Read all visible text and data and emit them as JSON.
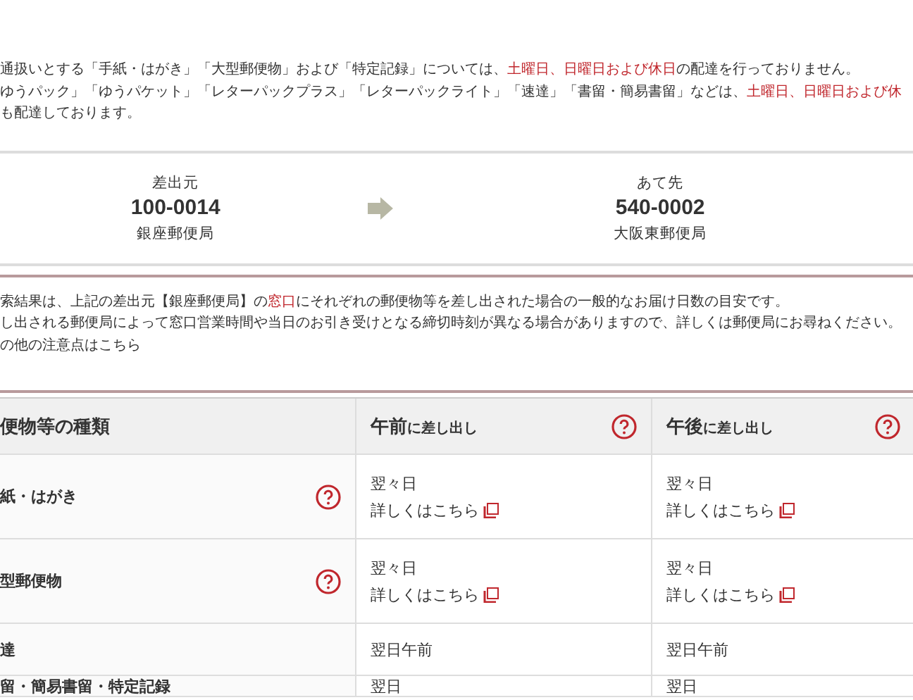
{
  "notice_top": {
    "lines": [
      [
        {
          "text": "通扱いとする「手紙・はがき」「大型郵便物」および「特定記録」については、",
          "emphasis": false
        },
        {
          "text": "土曜日、日曜日および休日",
          "emphasis": true
        },
        {
          "text": "の配達を行っておりません。",
          "emphasis": false
        }
      ],
      [
        {
          "text": "ゆうパック」「ゆうパケット」「レターパックプラス」「レターパックライト」「速達」「書留・簡易書留」などは、",
          "emphasis": false
        },
        {
          "text": "土曜日、日曜日および休",
          "emphasis": true
        }
      ],
      [
        {
          "text": "も配達しております。",
          "emphasis": false
        }
      ]
    ]
  },
  "route": {
    "from": {
      "label": "差出元",
      "postcode": "100-0014",
      "office": "銀座郵便局"
    },
    "to": {
      "label": "あて先",
      "postcode": "540-0002",
      "office": "大阪東郵便局"
    }
  },
  "search_note": {
    "lines": [
      [
        {
          "text": "索結果は、上記の差出元【銀座郵便局】の",
          "emphasis": false
        },
        {
          "text": "窓口",
          "emphasis": true
        },
        {
          "text": "にそれぞれの郵便物等を差し出された場合の一般的なお届け日数の目安です。",
          "emphasis": false
        }
      ],
      [
        {
          "text": "し出される郵便局によって窓口営業時間や当日のお引き受けとなる締切時刻が異なる場合がありますので、詳しくは郵便局にお尋ねください。",
          "emphasis": false
        }
      ],
      [
        {
          "text": "の他の注意点はこちら",
          "emphasis": false
        }
      ]
    ]
  },
  "table": {
    "columns": [
      {
        "main": "便物等の種類",
        "help": false
      },
      {
        "main": "午前",
        "sub": "に差し出し",
        "help": true
      },
      {
        "main": "午後",
        "sub": "に差し出し",
        "help": true
      }
    ],
    "rows": [
      {
        "cells": [
          {
            "kind": "type",
            "label": "紙・はがき",
            "help": true
          },
          {
            "kind": "days",
            "value": "翌々日",
            "link": "詳しくはこちら"
          },
          {
            "kind": "days",
            "value": "翌々日",
            "link": "詳しくはこちら"
          }
        ]
      },
      {
        "cells": [
          {
            "kind": "type",
            "label": "型郵便物",
            "help": true
          },
          {
            "kind": "days",
            "value": "翌々日",
            "link": "詳しくはこちら"
          },
          {
            "kind": "days",
            "value": "翌々日",
            "link": "詳しくはこちら"
          }
        ]
      },
      {
        "cells": [
          {
            "kind": "type",
            "label": "達",
            "help": false
          },
          {
            "kind": "days",
            "value": "翌日午前"
          },
          {
            "kind": "days",
            "value": "翌日午前"
          }
        ]
      },
      {
        "cells": [
          {
            "kind": "type",
            "label": "留・簡易書留・特定記録",
            "help": false
          },
          {
            "kind": "days",
            "value": "翌日"
          },
          {
            "kind": "days",
            "value": "翌日"
          }
        ]
      }
    ]
  }
}
